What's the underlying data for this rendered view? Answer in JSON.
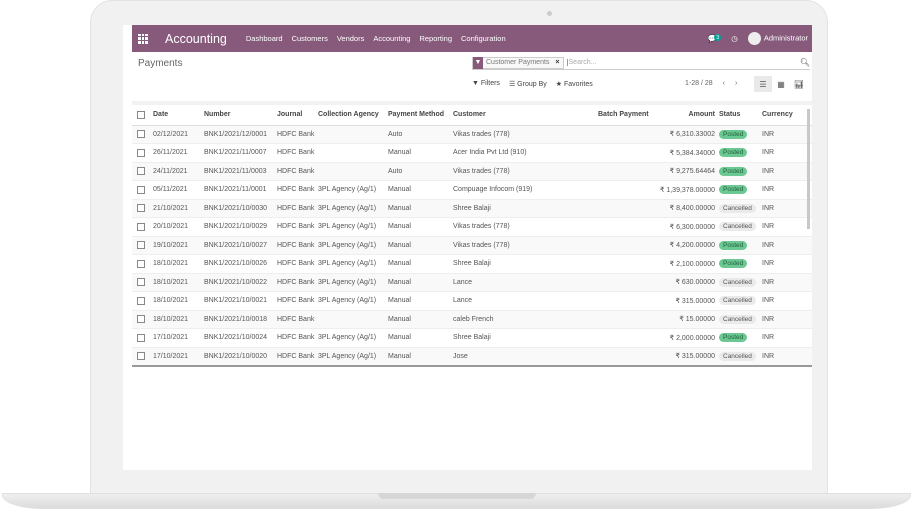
{
  "app": {
    "name": "Accounting",
    "menu": [
      "Dashboard",
      "Customers",
      "Vendors",
      "Accounting",
      "Reporting",
      "Configuration"
    ],
    "chat_count": "3",
    "user": "Administrator"
  },
  "page": {
    "title": "Payments"
  },
  "search": {
    "facet": "Customer Payments",
    "placeholder": "Search..."
  },
  "toolbar": {
    "filters": "Filters",
    "group_by": "Group By",
    "favorites": "Favorites",
    "pager": "1-28 / 28"
  },
  "colors": {
    "brand": "#875a7b",
    "posted": "#6cc893"
  },
  "table": {
    "headers": [
      "Date",
      "Number",
      "Journal",
      "Collection Agency",
      "Payment Method",
      "Customer",
      "Batch Payment",
      "Amount",
      "Status",
      "Currency"
    ],
    "rows": [
      [
        "02/12/2021",
        "BNK1/2021/12/0001",
        "HDFC Bank",
        "",
        "Auto",
        "Vikas trades (778)",
        "",
        "₹ 6,310.33002",
        "Posted",
        "INR"
      ],
      [
        "26/11/2021",
        "BNK1/2021/11/0007",
        "HDFC Bank",
        "",
        "Manual",
        "Acer India Pvt Ltd (910)",
        "",
        "₹ 5,384.34000",
        "Posted",
        "INR"
      ],
      [
        "24/11/2021",
        "BNK1/2021/11/0003",
        "HDFC Bank",
        "",
        "Auto",
        "Vikas trades (778)",
        "",
        "₹ 9,275.64464",
        "Posted",
        "INR"
      ],
      [
        "05/11/2021",
        "BNK1/2021/11/0001",
        "HDFC Bank",
        "3PL Agency (Ag/1)",
        "Manual",
        "Compuage Infocom (919)",
        "",
        "₹ 1,39,378.00000",
        "Posted",
        "INR"
      ],
      [
        "21/10/2021",
        "BNK1/2021/10/0030",
        "HDFC Bank",
        "3PL Agency (Ag/1)",
        "Manual",
        "Shree Balaji",
        "",
        "₹ 8,400.00000",
        "Cancelled",
        "INR"
      ],
      [
        "20/10/2021",
        "BNK1/2021/10/0029",
        "HDFC Bank",
        "3PL Agency (Ag/1)",
        "Manual",
        "Vikas trades (778)",
        "",
        "₹ 6,300.00000",
        "Cancelled",
        "INR"
      ],
      [
        "19/10/2021",
        "BNK1/2021/10/0027",
        "HDFC Bank",
        "3PL Agency (Ag/1)",
        "Manual",
        "Vikas trades (778)",
        "",
        "₹ 4,200.00000",
        "Posted",
        "INR"
      ],
      [
        "18/10/2021",
        "BNK1/2021/10/0026",
        "HDFC Bank",
        "3PL Agency (Ag/1)",
        "Manual",
        "Shree Balaji",
        "",
        "₹ 2,100.00000",
        "Posted",
        "INR"
      ],
      [
        "18/10/2021",
        "BNK1/2021/10/0022",
        "HDFC Bank",
        "3PL Agency (Ag/1)",
        "Manual",
        "Lance",
        "",
        "₹ 630.00000",
        "Cancelled",
        "INR"
      ],
      [
        "18/10/2021",
        "BNK1/2021/10/0021",
        "HDFC Bank",
        "3PL Agency (Ag/1)",
        "Manual",
        "Lance",
        "",
        "₹ 315.00000",
        "Cancelled",
        "INR"
      ],
      [
        "18/10/2021",
        "BNK1/2021/10/0018",
        "HDFC Bank",
        "",
        "Manual",
        "caleb French",
        "",
        "₹ 15.00000",
        "Cancelled",
        "INR"
      ],
      [
        "17/10/2021",
        "BNK1/2021/10/0024",
        "HDFC Bank",
        "3PL Agency (Ag/1)",
        "Manual",
        "Shree Balaji",
        "",
        "₹ 2,000.00000",
        "Posted",
        "INR"
      ],
      [
        "17/10/2021",
        "BNK1/2021/10/0020",
        "HDFC Bank",
        "3PL Agency (Ag/1)",
        "Manual",
        "Jose",
        "",
        "₹ 315.00000",
        "Cancelled",
        "INR"
      ]
    ]
  }
}
